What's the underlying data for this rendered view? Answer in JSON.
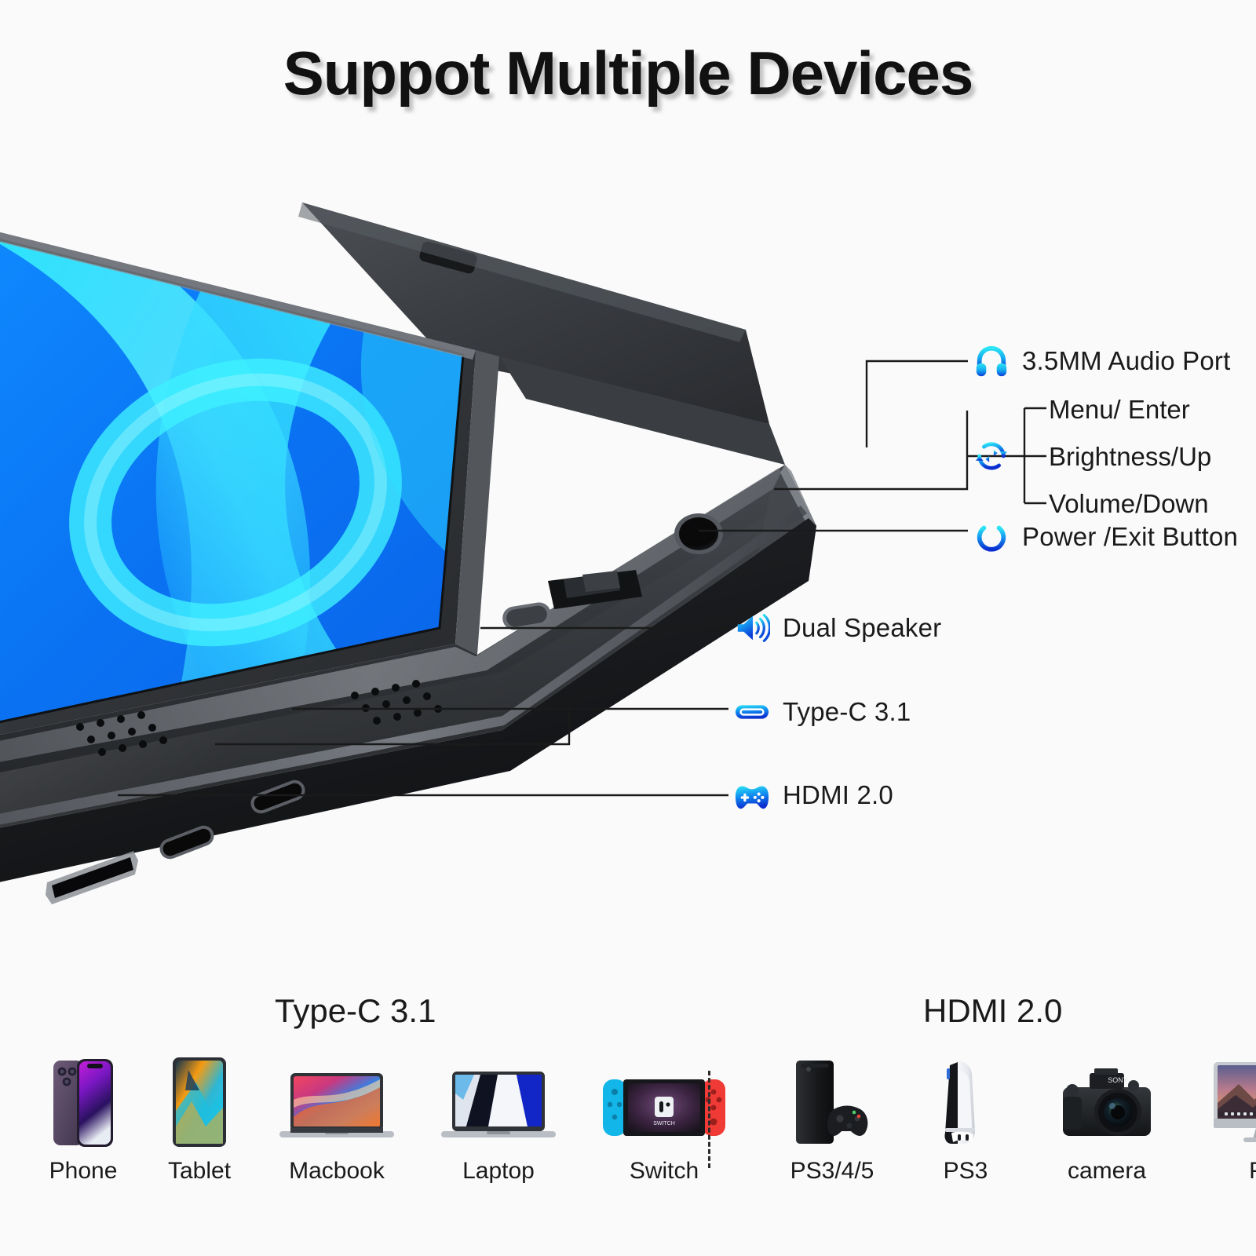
{
  "page": {
    "title": "Suppot Multiple Devices",
    "background_color": "#fafafa",
    "accent_cyan": "#1fd8f0",
    "accent_blue": "#0b3fd8"
  },
  "callouts": [
    {
      "id": "audio",
      "icon": "headphones-icon",
      "label": "3.5MM Audio Port"
    },
    {
      "id": "osd",
      "icon": "sync-arrows-icon",
      "label": ""
    },
    {
      "id": "power",
      "icon": "power-icon",
      "label": "Power /Exit Button"
    },
    {
      "id": "speaker",
      "icon": "speaker-icon",
      "label": "Dual Speaker"
    },
    {
      "id": "typec",
      "icon": "usb-c-port-icon",
      "label": "Type-C 3.1"
    },
    {
      "id": "hdmi",
      "icon": "gamepad-icon",
      "label": "HDMI 2.0"
    }
  ],
  "osd_functions": [
    "Menu/ Enter",
    "Brightness/Up",
    "Volume/Down"
  ],
  "sections": [
    {
      "id": "type-c-section",
      "title": "Type-C 3.1",
      "devices": [
        {
          "name": "phone-device",
          "art": "iphone",
          "caption": "Phone"
        },
        {
          "name": "tablet-device",
          "art": "ipad",
          "caption": "Tablet"
        },
        {
          "name": "macbook-device",
          "art": "macbook",
          "caption": "Macbook"
        },
        {
          "name": "laptop-device",
          "art": "laptop",
          "caption": "Laptop"
        },
        {
          "name": "switch-device",
          "art": "switch",
          "caption": "Switch"
        }
      ]
    },
    {
      "id": "hdmi-section",
      "title": "HDMI 2.0",
      "devices": [
        {
          "name": "console-xbox-device",
          "art": "xbox",
          "caption": "PS3/4/5"
        },
        {
          "name": "console-ps-device",
          "art": "ps5",
          "caption": "PS3"
        },
        {
          "name": "camera-device",
          "art": "camera",
          "caption": "camera"
        },
        {
          "name": "pc-device",
          "art": "imac",
          "caption": "PC"
        }
      ]
    }
  ]
}
